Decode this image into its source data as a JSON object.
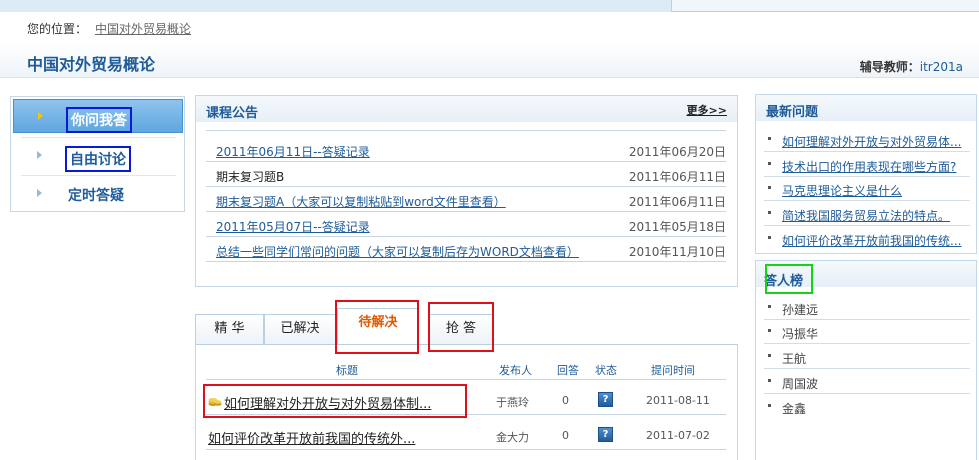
{
  "breadcrumb": {
    "label": "您的位置：",
    "link": "中国对外贸易概论"
  },
  "header": {
    "course_title": "中国对外贸易概论",
    "tutor_label": "辅导教师：",
    "tutor_value": "itr201a"
  },
  "left_menu": {
    "items": [
      {
        "label": "你问我答",
        "active": true
      },
      {
        "label": "自由讨论",
        "active": false
      },
      {
        "label": "定时答疑",
        "active": false
      }
    ]
  },
  "announcements": {
    "title": "课程公告",
    "more": "更多>>",
    "rows": [
      {
        "text": "2011年06月11日--答疑记录",
        "date": "2011年06月20日",
        "link": true
      },
      {
        "text": "期末复习题B",
        "date": "2011年06月11日",
        "link": false
      },
      {
        "text": "期末复习题A（大家可以复制粘贴到word文件里查看）",
        "date": "2011年06月11日",
        "link": true
      },
      {
        "text": "2011年05月07日--答疑记录",
        "date": "2011年05月18日",
        "link": true
      },
      {
        "text": "总结一些同学们常问的问题（大家可以复制后存为WORD文档查看）",
        "date": "2010年11月10日",
        "link": true
      }
    ]
  },
  "tabs": [
    {
      "label": "精 华"
    },
    {
      "label": "已解决"
    },
    {
      "label": "待解决",
      "active": true
    },
    {
      "label": "抢 答"
    }
  ],
  "questions": {
    "headers": {
      "title": "标题",
      "author": "发布人",
      "answers": "回答",
      "status": "状态",
      "time": "提问时间"
    },
    "rows": [
      {
        "title": "如何理解对外开放与对外贸易体制...",
        "author": "于燕玲",
        "answers": "0",
        "status": "?",
        "time": "2011-08-11",
        "coin": true
      },
      {
        "title": "如何评价改革开放前我国的传统外...",
        "author": "金大力",
        "answers": "0",
        "status": "?",
        "time": "2011-07-02",
        "coin": false
      }
    ]
  },
  "latest": {
    "title": "最新问题",
    "items": [
      "如何理解对外开放与对外贸易体...",
      "技术出口的作用表现在哪些方面?",
      "马克思理论主义是什么",
      "简述我国服务贸易立法的特点。",
      "如何评价改革开放前我国的传统..."
    ]
  },
  "ranking": {
    "title": "答人榜",
    "items": [
      "孙建远",
      "冯振华",
      "王航",
      "周国波",
      "金鑫"
    ]
  }
}
